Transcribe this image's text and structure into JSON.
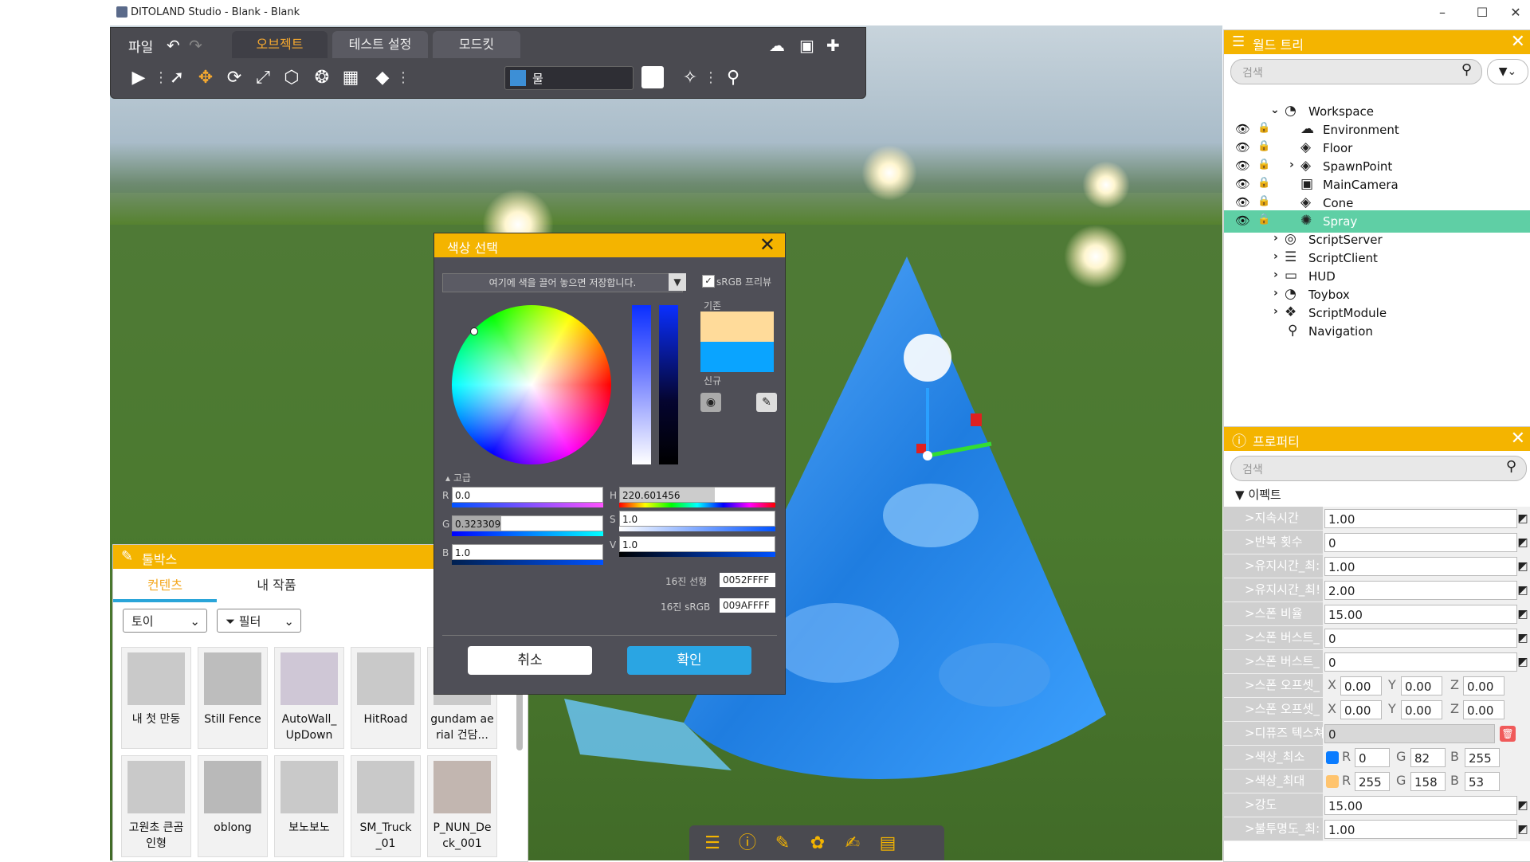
{
  "window": {
    "title": "DITOLAND Studio - Blank - Blank",
    "minimize": "–",
    "maximize": "☐",
    "close": "✕"
  },
  "toolbar": {
    "file_menu": "파일",
    "tabs": [
      {
        "label": "오브젝트",
        "active": true
      },
      {
        "label": "테스트 설정",
        "active": false
      },
      {
        "label": "모드킷",
        "active": false
      }
    ],
    "material": "물",
    "accent_color": "#f4a830"
  },
  "world_tree": {
    "title": "월드 트리",
    "search_placeholder": "검색",
    "items": [
      {
        "label": "Workspace",
        "icon": "workspace-icon",
        "expanded": true
      },
      {
        "label": "Environment",
        "icon": "cloud-icon",
        "visible": true,
        "locked": false
      },
      {
        "label": "Floor",
        "icon": "cube-icon",
        "visible": true,
        "locked": true
      },
      {
        "label": "SpawnPoint",
        "icon": "cube-icon",
        "visible": true,
        "locked": false,
        "collapsed": true
      },
      {
        "label": "MainCamera",
        "icon": "camera-icon",
        "visible": true,
        "locked": false
      },
      {
        "label": "Cone",
        "icon": "cube-icon",
        "visible": true,
        "locked": false
      },
      {
        "label": "Spray",
        "icon": "spray-icon",
        "visible": true,
        "locked": false,
        "selected": true
      },
      {
        "label": "ScriptServer",
        "icon": "server-icon"
      },
      {
        "label": "ScriptClient",
        "icon": "client-icon"
      },
      {
        "label": "HUD",
        "icon": "hud-icon"
      },
      {
        "label": "Toybox",
        "icon": "toybox-icon"
      },
      {
        "label": "ScriptModule",
        "icon": "module-icon"
      },
      {
        "label": "Navigation",
        "icon": "pin-icon"
      }
    ]
  },
  "properties": {
    "title": "프로퍼티",
    "search_placeholder": "검색",
    "section": "이펙트",
    "rows": [
      {
        "key": ">지속시간",
        "value": "1.00"
      },
      {
        "key": ">반복 횟수",
        "value": "0"
      },
      {
        "key": ">유지시간_최:",
        "value": "1.00"
      },
      {
        "key": ">유지시간_최!",
        "value": "2.00"
      },
      {
        "key": ">스폰 비율",
        "value": "15.00"
      },
      {
        "key": ">스폰 버스트_",
        "value": "0"
      },
      {
        "key": ">스폰 버스트_",
        "value": "0"
      }
    ],
    "offset_rows": [
      {
        "key": ">스폰 오프셋_",
        "x": "0.00",
        "y": "0.00",
        "z": "0.00"
      },
      {
        "key": ">스폰 오프셋_",
        "x": "0.00",
        "y": "0.00",
        "z": "0.00"
      }
    ],
    "diffuse": {
      "key": ">디퓨즈 텍스쳐",
      "value": "0"
    },
    "color_min": {
      "key": ">색상_최소",
      "r": "0",
      "g": "82",
      "b": "255",
      "swatch": "#0052ff"
    },
    "color_max": {
      "key": ">색상_최대",
      "r": "255",
      "g": "158",
      "b": "53",
      "swatch": "#ff9e35"
    },
    "tail_rows": [
      {
        "key": ">강도",
        "value": "15.00"
      },
      {
        "key": ">불투명도_최:",
        "value": "1.00"
      }
    ],
    "axis": {
      "x": "X",
      "y": "Y",
      "z": "Z",
      "r": "R",
      "g": "G",
      "b": "B"
    }
  },
  "toolbox": {
    "title": "툴박스",
    "tabs": [
      "컨텐츠",
      "내 작품"
    ],
    "category": "토이",
    "filter": "필터",
    "items": [
      {
        "name": "내 첫 만둥"
      },
      {
        "name": "Still Fence"
      },
      {
        "name": "AutoWall_ UpDown"
      },
      {
        "name": "HitRoad"
      },
      {
        "name": "gundam ae rial 건담..."
      },
      {
        "name": "고원초 큰곰 인형"
      },
      {
        "name": "oblong"
      },
      {
        "name": "보노보노"
      },
      {
        "name": "SM_Truck _01"
      },
      {
        "name": "P_NUN_De ck_001"
      }
    ]
  },
  "color_picker": {
    "title": "색상 선택",
    "drop_hint": "여기에 색을 끌어 놓으면 저장합니다.",
    "srgb_preview": "sRGB 프리뷰",
    "srgb_checked": true,
    "base_label": "기존",
    "new_label": "신규",
    "base_color": "#ffdb9a",
    "new_color": "#0aa4ff",
    "advanced": "고급",
    "r_label": "R",
    "g_label": "G",
    "b_label": "B",
    "h_label": "H",
    "s_label": "S",
    "v_label": "V",
    "r": "0.0",
    "g": "0.323309",
    "b": "1.0",
    "h": "220.601456",
    "s": "1.0",
    "v": "1.0",
    "g_fraction": 0.3233,
    "h_fraction": 0.6128,
    "hex_linear_label": "16진 선형",
    "hex_linear": "0052FFFF",
    "hex_srgb_label": "16진 sRGB",
    "hex_srgb": "009AFFFF",
    "cancel": "취소",
    "ok": "확인"
  }
}
